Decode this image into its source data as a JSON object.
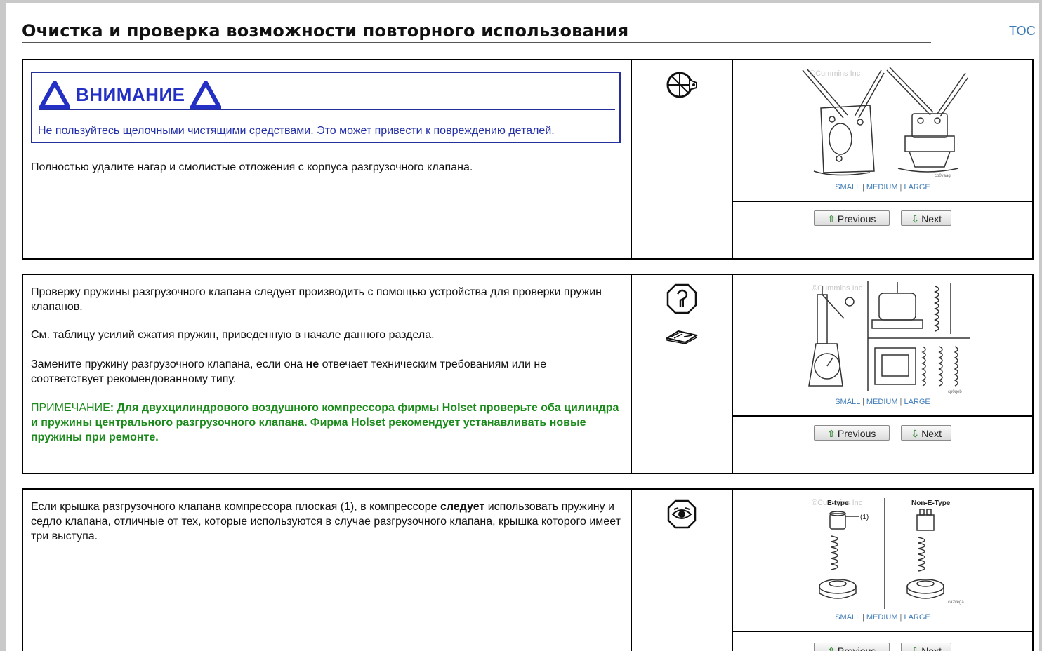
{
  "header": {
    "title": "Очистка и проверка возможности повторного использования",
    "toc_label": "TOC"
  },
  "image_size_links": {
    "small": "SMALL",
    "medium": "MEDIUM",
    "large": "LARGE",
    "sep": "|"
  },
  "nav": {
    "previous": "Previous",
    "next": "Next"
  },
  "steps": [
    {
      "warning_title": "ВНИМАНИЕ",
      "warning_text": "Не пользуйтесь щелочными чистящими средствами. Это может привести к повреждению деталей.",
      "text": "Полностью удалите нагар и смолистые отложения с корпуса разгрузочного клапана.",
      "icons": [
        "cleaning-brush-icon"
      ],
      "image": {
        "watermark": "©Cummins Inc",
        "code": "cp0vaag"
      }
    },
    {
      "p1": "Проверку пружины разгрузочного клапана следует производить с помощью устройства для проверки пружин клапанов.",
      "p2": "См. таблицу усилий сжатия пружин, приведенную в начале данного раздела.",
      "p3_before": "Замените пружину разгрузочного клапана, если она ",
      "p3_bold": "не",
      "p3_after": " отвечает техническим требованиям или не соответствует рекомендованному типу.",
      "note_label": "ПРИМЕЧАНИЕ",
      "note_text": ": Для двухцилиндрового воздушного компрессора фирмы Holset проверьте оба цилиндра и пружины центрального разгрузочного клапана. Фирма Holset рекомендует устанавливать новые пружины при ремонте.",
      "icons": [
        "spring-gauge-icon",
        "specifications-book-icon"
      ],
      "image": {
        "watermark": "©Cummins Inc",
        "code": "cp0qeb"
      }
    },
    {
      "p1_before": "Если крышка разгрузочного клапана компрессора плоская (1), в компрессоре ",
      "p1_bold": "следует",
      "p1_after": " использовать пружину и седло клапана, отличные от тех, которые используются в случае разгрузочного клапана, крышка которого имеет три выступа.",
      "icons": [
        "inspect-eye-icon"
      ],
      "image": {
        "watermark": "©Cummins Inc",
        "label_left": "E-type",
        "label_right": "Non-E-Type",
        "callout": "(1)",
        "code": "ca2vega"
      }
    }
  ]
}
